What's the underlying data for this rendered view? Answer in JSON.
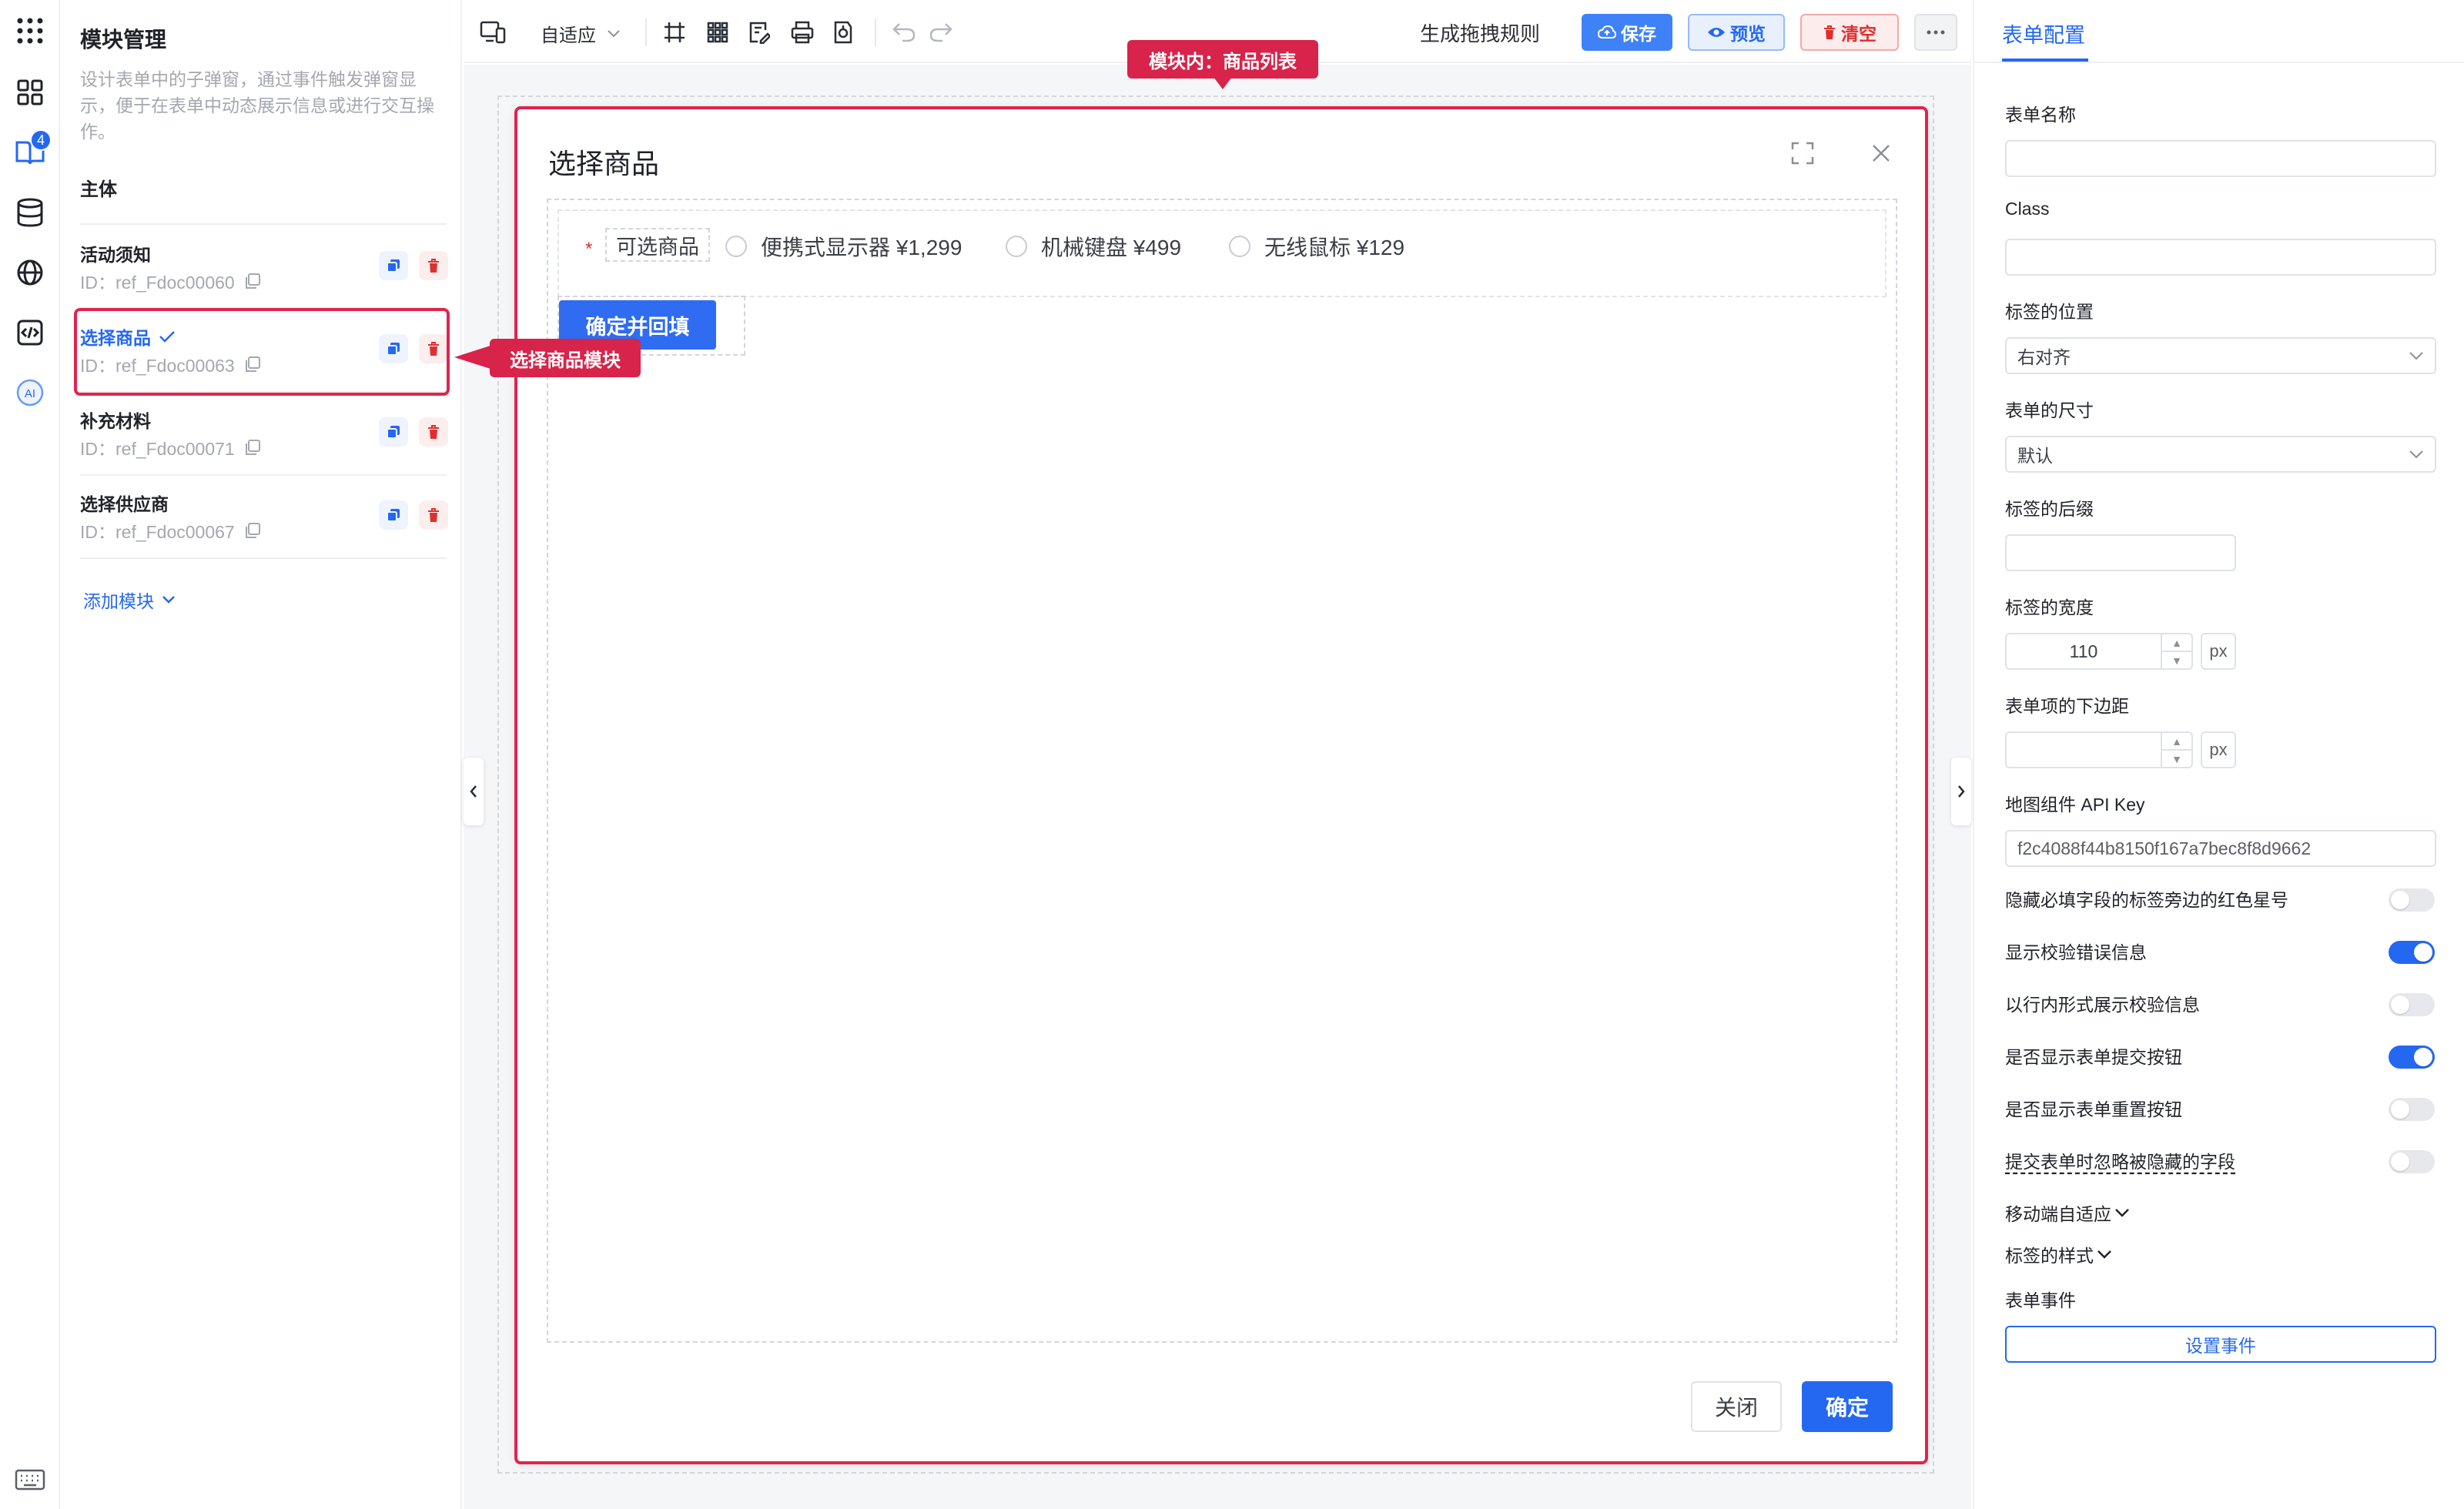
{
  "rail": {
    "badge_count": "4",
    "ai_label": "AI"
  },
  "modules": {
    "title": "模块管理",
    "description": "设计表单中的子弹窗，通过事件触发弹窗显示，便于在表单中动态展示信息或进行交互操作。",
    "main_label": "主体",
    "id_prefix": "ID：",
    "items": [
      {
        "name": "活动须知",
        "id": "ref_Fdoc00060",
        "selected": false
      },
      {
        "name": "选择商品",
        "id": "ref_Fdoc00063",
        "selected": true
      },
      {
        "name": "补充材料",
        "id": "ref_Fdoc00071",
        "selected": false
      },
      {
        "name": "选择供应商",
        "id": "ref_Fdoc00067",
        "selected": false
      }
    ],
    "add_label": "添加模块"
  },
  "toolbar": {
    "layout_mode": "自适应",
    "generate_rule": "生成拖拽规则",
    "save": "保存",
    "preview": "预览",
    "clear": "清空",
    "colors": {
      "primary": "#2468f2",
      "danger": "#e02e2e"
    }
  },
  "dialog": {
    "title": "选择商品",
    "field_label": "可选商品",
    "required_mark": "*",
    "options": [
      "便携式显示器 ¥1,299",
      "机械键盘 ¥499",
      "无线鼠标 ¥129"
    ],
    "confirm_fill": "确定并回填",
    "close": "关闭",
    "ok": "确定"
  },
  "annotations": {
    "top": "模块内：商品列表",
    "side": "选择商品模块",
    "color": "#d8234a"
  },
  "config": {
    "tab": "表单配置",
    "form_name_label": "表单名称",
    "form_name_value": "",
    "class_label": "Class",
    "class_value": "",
    "label_position_label": "标签的位置",
    "label_position_value": "右对齐",
    "form_size_label": "表单的尺寸",
    "form_size_value": "默认",
    "label_suffix_label": "标签的后缀",
    "label_suffix_value": "",
    "label_width_label": "标签的宽度",
    "label_width_value": "110",
    "item_margin_label": "表单项的下边距",
    "item_margin_value": "",
    "unit_px": "px",
    "api_key_label": "地图组件 API Key",
    "api_key_value": "f2c4088f44b8150f167a7bec8f8d9662",
    "switches": [
      {
        "label": "隐藏必填字段的标签旁边的红色星号",
        "on": false
      },
      {
        "label": "显示校验错误信息",
        "on": true
      },
      {
        "label": "以行内形式展示校验信息",
        "on": false
      },
      {
        "label": "是否显示表单提交按钮",
        "on": true
      },
      {
        "label": "是否显示表单重置按钮",
        "on": false
      },
      {
        "label": "提交表单时忽略被隐藏的字段",
        "on": false
      }
    ],
    "mobile_adapt": "移动端自适应",
    "label_style": "标签的样式",
    "events_label": "表单事件",
    "set_events": "设置事件"
  }
}
